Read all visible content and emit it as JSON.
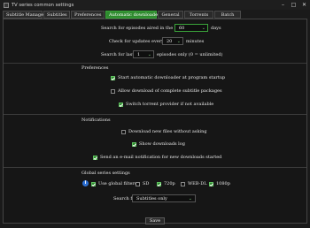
{
  "window": {
    "title": "TV series common settings"
  },
  "tabs": [
    {
      "label": "Subtitle Manager"
    },
    {
      "label": "Subtitles"
    },
    {
      "label": "Preferences"
    },
    {
      "label": "Automatic downloader"
    },
    {
      "label": "General"
    },
    {
      "label": "Torrents"
    },
    {
      "label": "Batch"
    }
  ],
  "search": {
    "aired_label": "Search for episodes aired in the last",
    "aired_value": "60",
    "aired_unit": "days",
    "check_label": "Check for updates every",
    "check_value": "20",
    "check_unit": "minutes",
    "last_label": "Search for last",
    "last_value": "1",
    "last_unit": "episodes only (0 = unlimited)"
  },
  "preferences": {
    "heading": "Preferences",
    "opt_startup": "Start automatic downloader at program startup",
    "opt_complete": "Allow download of complete subtitle packages",
    "opt_switch": "Switch torrent provider if not available"
  },
  "notifications": {
    "heading": "Notifications",
    "opt_download": "Download new files without asking",
    "opt_log": "Show downloads log",
    "opt_email": "Send an e-mail notification for new downloads started"
  },
  "global": {
    "heading": "Global series settings",
    "use_filters": "Use global filters",
    "sd": "SD",
    "p720": "720p",
    "webdl": "WEB-DL",
    "p1080": "1080p",
    "search_for_label": "Search for",
    "search_for_value": "Subtitles only"
  },
  "buttons": {
    "save": "Save"
  },
  "colors": {
    "accent": "#2e8b2e",
    "info": "#2d6fd1",
    "background": "#1a1a1a"
  }
}
